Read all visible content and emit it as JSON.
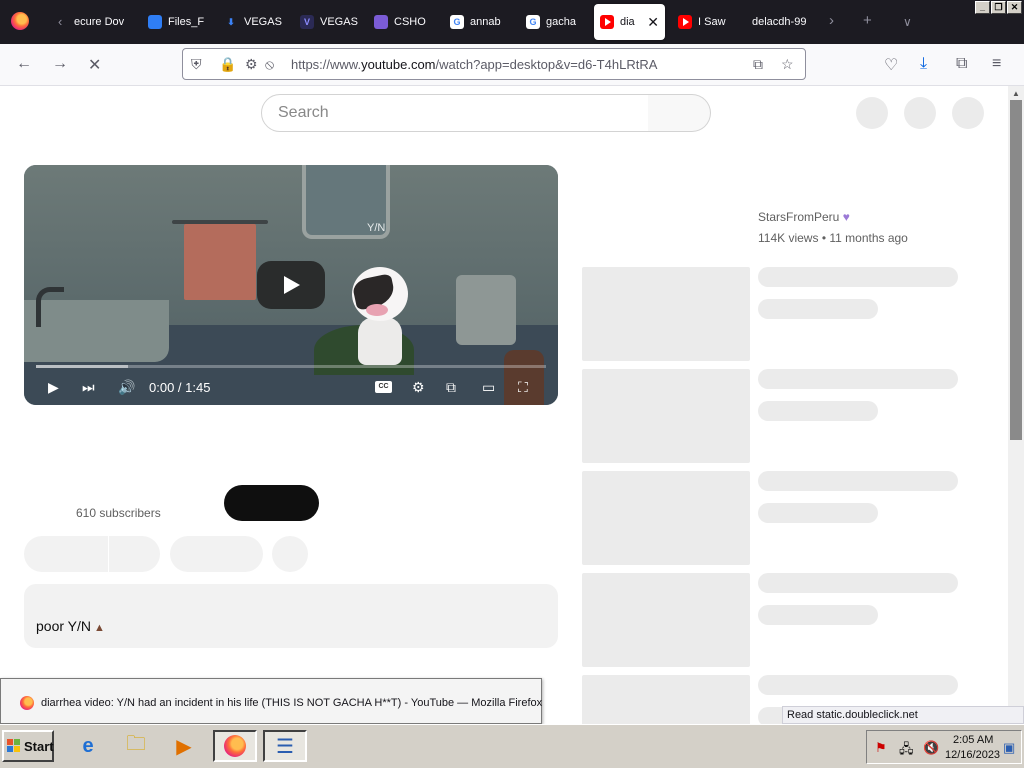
{
  "browser": {
    "tabs": [
      {
        "label": "ecure Dov",
        "icon": "lock-icon"
      },
      {
        "label": "Files_F",
        "icon": "edge-icon"
      },
      {
        "label": "VEGAS",
        "icon": "download-icon"
      },
      {
        "label": "VEGAS",
        "icon": "vegas-icon"
      },
      {
        "label": "CSHO",
        "icon": "cshop-icon"
      },
      {
        "label": "annab",
        "icon": "google-icon"
      },
      {
        "label": "gacha",
        "icon": "google-icon"
      },
      {
        "label": "diar",
        "icon": "youtube-icon",
        "active": true
      },
      {
        "label": "I Saw",
        "icon": "youtube-icon"
      },
      {
        "label": "delacdh-99",
        "icon": ""
      }
    ],
    "url_prefix": "https://www.",
    "url_domain": "youtube.com",
    "url_rest": "/watch?app=desktop&v=d6-T4hLRtRA"
  },
  "page": {
    "search_placeholder": "Search",
    "player": {
      "watermark": "Y/N",
      "time": "0:00 / 1:45",
      "buffered_fraction": 0.18
    },
    "channel_name": "StarsFromPeru",
    "views": "114K views",
    "age": "11 months ago",
    "subscribers": "610 subscribers",
    "description": "poor Y/N"
  },
  "status_text": "Read static.doubleclick.net",
  "tooltip": "diarrhea video: Y/N had an incident in his life (THIS IS NOT GACHA H**T) - YouTube — Mozilla Firefox",
  "taskbar": {
    "start_label": "Start",
    "clock_time": "2:05 AM",
    "clock_date": "12/16/2023"
  }
}
